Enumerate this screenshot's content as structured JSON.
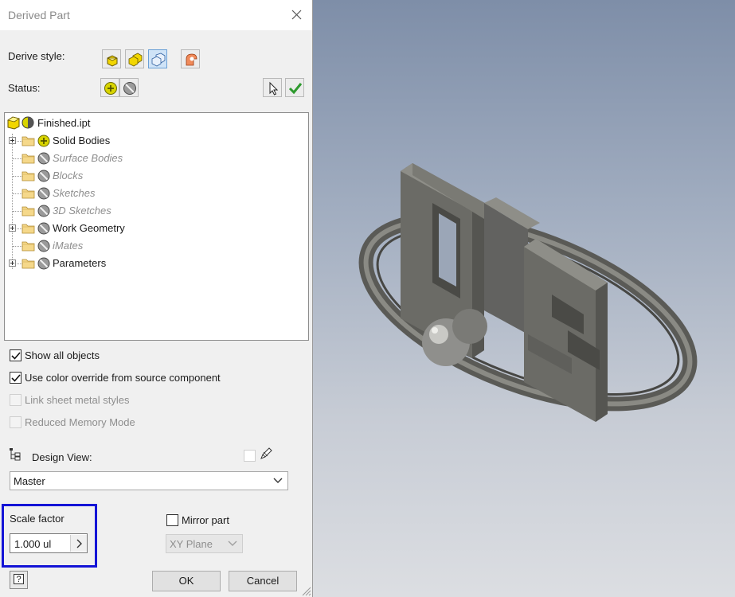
{
  "dialog": {
    "title": "Derived Part",
    "derive_style_label": "Derive style:",
    "status_label": "Status:",
    "tree": {
      "root": "Finished.ipt",
      "items": [
        {
          "label": "Solid Bodies",
          "expandable": true,
          "enabled": true,
          "status": "include"
        },
        {
          "label": "Surface Bodies",
          "expandable": false,
          "enabled": false,
          "status": "exclude"
        },
        {
          "label": "Blocks",
          "expandable": false,
          "enabled": false,
          "status": "exclude"
        },
        {
          "label": "Sketches",
          "expandable": false,
          "enabled": false,
          "status": "exclude"
        },
        {
          "label": "3D Sketches",
          "expandable": false,
          "enabled": false,
          "status": "exclude"
        },
        {
          "label": "Work Geometry",
          "expandable": true,
          "enabled": true,
          "status": "exclude"
        },
        {
          "label": "iMates",
          "expandable": false,
          "enabled": false,
          "status": "exclude"
        },
        {
          "label": "Parameters",
          "expandable": true,
          "enabled": true,
          "status": "exclude"
        }
      ]
    },
    "options": {
      "show_all_objects": "Show all objects",
      "use_color_override": "Use color override from source component",
      "link_sheet_metal": "Link sheet metal styles",
      "reduced_memory": "Reduced Memory Mode"
    },
    "design_view_label": "Design View:",
    "design_view_value": "Master",
    "scale_factor_label": "Scale factor",
    "scale_factor_value": "1.000 ul",
    "mirror_part_label": "Mirror part",
    "mirror_plane_value": "XY Plane",
    "ok_label": "OK",
    "cancel_label": "Cancel",
    "help_label": "?"
  },
  "colors": {
    "highlight_border": "#1414d6",
    "include_icon": "#d8d400",
    "check_green": "#2e9a2e"
  }
}
